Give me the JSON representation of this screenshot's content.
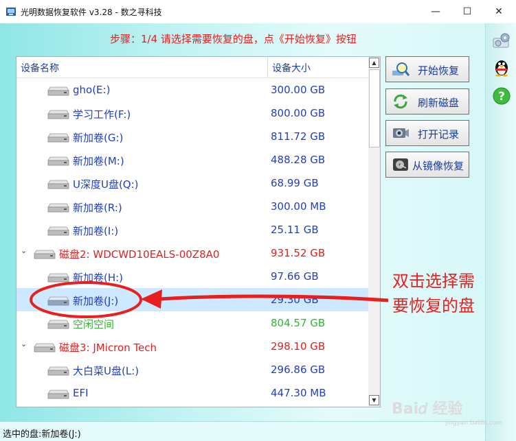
{
  "window": {
    "title": "光明数据恢复软件 v3.28 - 数之寻科技",
    "minimize_symbol": "—",
    "maximize_symbol": "☐",
    "close_symbol": "✕"
  },
  "step_text": "步骤：1/4 请选择需要恢复的盘，点《开始恢复》按钮",
  "table": {
    "columns": [
      "设备名称",
      "设备大小"
    ],
    "rows": [
      {
        "name": "gho(E:)",
        "size": "300.00 GB",
        "level": 2,
        "kind": "volume",
        "expander": "",
        "color": "#1f3fc0"
      },
      {
        "name": "学习工作(F:)",
        "size": "800.00 GB",
        "level": 2,
        "kind": "volume",
        "expander": "",
        "color": "#1f3fc0"
      },
      {
        "name": "新加卷(G:)",
        "size": "811.72 GB",
        "level": 2,
        "kind": "volume",
        "expander": "",
        "color": "#1f3fc0"
      },
      {
        "name": "新加卷(M:)",
        "size": "488.28 GB",
        "level": 2,
        "kind": "volume",
        "expander": "",
        "color": "#1f3fc0"
      },
      {
        "name": "U深度U盘(Q:)",
        "size": "68.99 GB",
        "level": 2,
        "kind": "volume",
        "expander": "",
        "color": "#1f3fc0"
      },
      {
        "name": "新加卷(R:)",
        "size": "300.00 MB",
        "level": 2,
        "kind": "volume",
        "expander": "",
        "color": "#1f3fc0"
      },
      {
        "name": "新加卷(I:)",
        "size": "25.11 GB",
        "level": 2,
        "kind": "volume",
        "expander": "",
        "color": "#1f3fc0"
      },
      {
        "name": "磁盘2: WDCWD10EALS-00Z8A0",
        "size": "931.52 GB",
        "level": 1,
        "kind": "disk",
        "expander": "⌄",
        "color": "#e02020"
      },
      {
        "name": "新加卷(H:)",
        "size": "97.66 GB",
        "level": 2,
        "kind": "volume",
        "expander": "",
        "color": "#1f3fc0"
      },
      {
        "name": "新加卷(J:)",
        "size": "29.30 GB",
        "level": 2,
        "kind": "volume",
        "expander": "",
        "color": "#1f3fc0",
        "selected": true
      },
      {
        "name": "空闲空间",
        "size": "804.57 GB",
        "level": 2,
        "kind": "free",
        "expander": "",
        "color": "#2fb52f"
      },
      {
        "name": "磁盘3: JMicron  Tech",
        "size": "298.10 GB",
        "level": 1,
        "kind": "disk",
        "expander": "⌄",
        "color": "#e02020"
      },
      {
        "name": "大白菜U盘(L:)",
        "size": "296.86 GB",
        "level": 2,
        "kind": "volume",
        "expander": "",
        "color": "#1f3fc0"
      },
      {
        "name": "EFI",
        "size": "447.30 MB",
        "level": 2,
        "kind": "volume",
        "expander": "",
        "color": "#1f3fc0"
      }
    ]
  },
  "scrollbar": {
    "up_symbol": "▲",
    "down_symbol": "▼"
  },
  "buttons": {
    "start": "开始恢复",
    "refresh": "刷新磁盘",
    "open_record": "打开记录",
    "image_restore": "从镜像恢复"
  },
  "side_icons": [
    "settings-icon",
    "qq-penguin-icon",
    "help-icon"
  ],
  "status_text": "选中的盘:新加卷(J:)",
  "annotation": {
    "line1": "双击选择需",
    "line2": "要恢复的盘"
  },
  "watermark": {
    "main": "Bai𝑑 经验",
    "sub": "jingyan.baidu.com"
  },
  "colors": {
    "accent_red": "#e81c1c",
    "volume_blue": "#1f3fc0",
    "free_green": "#2fb52f"
  }
}
